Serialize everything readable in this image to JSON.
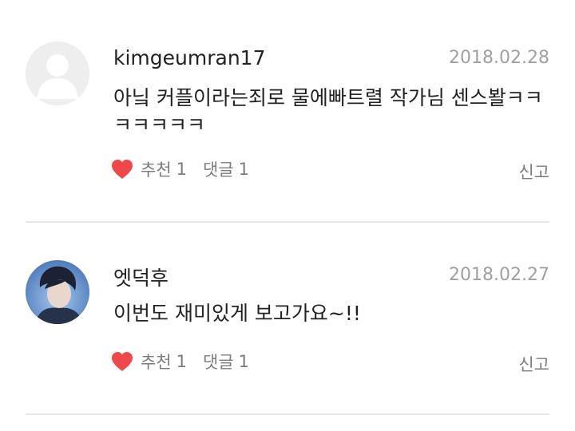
{
  "comments": [
    {
      "username": "kimgeumran17",
      "date": "2018.02.28",
      "text": "아닠 커플이라는죄로 물에빠트렬 작가님 센스봘ㅋㅋㅋㅋㅋㅋㅋ",
      "avatar_icon": "default-user-icon",
      "recommend_label": "추천",
      "recommend_count": "1",
      "reply_label": "댓글",
      "reply_count": "1",
      "report_label": "신고"
    },
    {
      "username": "엣덕후",
      "date": "2018.02.27",
      "text": "이번도 재미있게 보고가요~!!",
      "avatar_icon": "user-photo",
      "recommend_label": "추천",
      "recommend_count": "1",
      "reply_label": "댓글",
      "reply_count": "1",
      "report_label": "신고"
    }
  ],
  "colors": {
    "heart": "#f04848",
    "meta_text": "#7c7c7c",
    "date_text": "#a0a0a0",
    "divider": "#e8e8e8"
  }
}
